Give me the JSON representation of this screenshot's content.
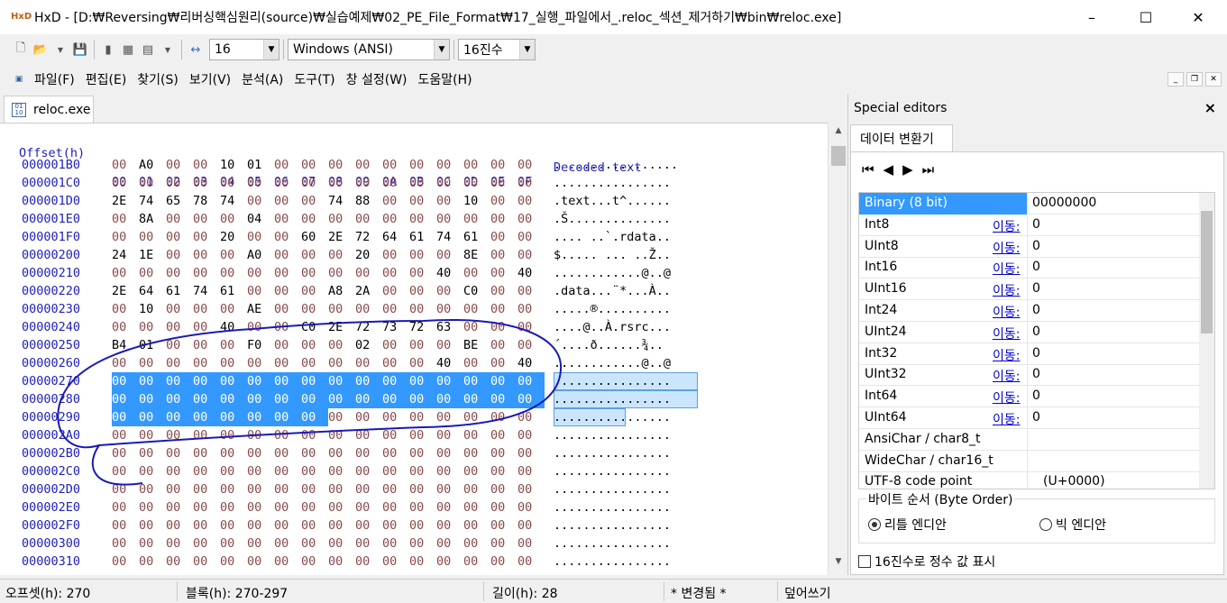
{
  "window": {
    "app_icon": "HxD",
    "title": "HxD - [D:₩Reversing₩리버싱핵심원리(source)₩실습예제₩02_PE_File_Format₩17_실행_파일에서_.reloc_섹션_제거하기₩bin₩reloc.exe]",
    "minimize": "–",
    "maximize": "☐",
    "close": "✕"
  },
  "toolbar": {
    "bytes_per_row": "16",
    "charset": "Windows (ANSI)",
    "base": "16진수"
  },
  "menu": [
    "파일(F)",
    "편집(E)",
    "찾기(S)",
    "보기(V)",
    "분석(A)",
    "도구(T)",
    "창 설정(W)",
    "도움말(H)"
  ],
  "document": {
    "tab_label": "reloc.exe",
    "icon": "file-icon"
  },
  "hex": {
    "header_offset": "Offset(h)",
    "header_cols": [
      "00",
      "01",
      "02",
      "03",
      "04",
      "05",
      "06",
      "07",
      "08",
      "09",
      "0A",
      "0B",
      "0C",
      "0D",
      "0E",
      "0F"
    ],
    "header_decoded": "Decoded text",
    "rows": [
      {
        "offset": "000001B0",
        "bytes": [
          "00",
          "A0",
          "00",
          "00",
          "10",
          "01",
          "00",
          "00",
          "00",
          "00",
          "00",
          "00",
          "00",
          "00",
          "00",
          "00"
        ],
        "text": ". ..............."
      },
      {
        "offset": "000001C0",
        "bytes": [
          "00",
          "00",
          "00",
          "00",
          "00",
          "00",
          "00",
          "00",
          "00",
          "00",
          "00",
          "00",
          "00",
          "00",
          "00",
          "00"
        ],
        "text": "................"
      },
      {
        "offset": "000001D0",
        "bytes": [
          "2E",
          "74",
          "65",
          "78",
          "74",
          "00",
          "00",
          "00",
          "74",
          "88",
          "00",
          "00",
          "00",
          "10",
          "00",
          "00"
        ],
        "text": ".text...t^......"
      },
      {
        "offset": "000001E0",
        "bytes": [
          "00",
          "8A",
          "00",
          "00",
          "00",
          "04",
          "00",
          "00",
          "00",
          "00",
          "00",
          "00",
          "00",
          "00",
          "00",
          "00"
        ],
        "text": ".Š.............."
      },
      {
        "offset": "000001F0",
        "bytes": [
          "00",
          "00",
          "00",
          "00",
          "20",
          "00",
          "00",
          "60",
          "2E",
          "72",
          "64",
          "61",
          "74",
          "61",
          "00",
          "00"
        ],
        "text": ".... ..`.rdata.."
      },
      {
        "offset": "00000200",
        "bytes": [
          "24",
          "1E",
          "00",
          "00",
          "00",
          "A0",
          "00",
          "00",
          "00",
          "20",
          "00",
          "00",
          "00",
          "8E",
          "00",
          "00"
        ],
        "text": "$..... ... ..Ž.."
      },
      {
        "offset": "00000210",
        "bytes": [
          "00",
          "00",
          "00",
          "00",
          "00",
          "00",
          "00",
          "00",
          "00",
          "00",
          "00",
          "00",
          "40",
          "00",
          "00",
          "40"
        ],
        "text": "............@..@"
      },
      {
        "offset": "00000220",
        "bytes": [
          "2E",
          "64",
          "61",
          "74",
          "61",
          "00",
          "00",
          "00",
          "A8",
          "2A",
          "00",
          "00",
          "00",
          "C0",
          "00",
          "00"
        ],
        "text": ".data...¨*...À.."
      },
      {
        "offset": "00000230",
        "bytes": [
          "00",
          "10",
          "00",
          "00",
          "00",
          "AE",
          "00",
          "00",
          "00",
          "00",
          "00",
          "00",
          "00",
          "00",
          "00",
          "00"
        ],
        "text": ".....®.........."
      },
      {
        "offset": "00000240",
        "bytes": [
          "00",
          "00",
          "00",
          "00",
          "40",
          "00",
          "00",
          "C0",
          "2E",
          "72",
          "73",
          "72",
          "63",
          "00",
          "00",
          "00"
        ],
        "text": "....@..À.rsrc..."
      },
      {
        "offset": "00000250",
        "bytes": [
          "B4",
          "01",
          "00",
          "00",
          "00",
          "F0",
          "00",
          "00",
          "00",
          "02",
          "00",
          "00",
          "00",
          "BE",
          "00",
          "00"
        ],
        "text": "´....ð......¾.."
      },
      {
        "offset": "00000260",
        "bytes": [
          "00",
          "00",
          "00",
          "00",
          "00",
          "00",
          "00",
          "00",
          "00",
          "00",
          "00",
          "00",
          "40",
          "00",
          "00",
          "40"
        ],
        "text": "............@..@"
      },
      {
        "offset": "00000270",
        "bytes": [
          "00",
          "00",
          "00",
          "00",
          "00",
          "00",
          "00",
          "00",
          "00",
          "00",
          "00",
          "00",
          "00",
          "00",
          "00",
          "00"
        ],
        "text": "................"
      },
      {
        "offset": "00000280",
        "bytes": [
          "00",
          "00",
          "00",
          "00",
          "00",
          "00",
          "00",
          "00",
          "00",
          "00",
          "00",
          "00",
          "00",
          "00",
          "00",
          "00"
        ],
        "text": "................"
      },
      {
        "offset": "00000290",
        "bytes": [
          "00",
          "00",
          "00",
          "00",
          "00",
          "00",
          "00",
          "00",
          "00",
          "00",
          "00",
          "00",
          "00",
          "00",
          "00",
          "00"
        ],
        "text": "................"
      },
      {
        "offset": "000002A0",
        "bytes": [
          "00",
          "00",
          "00",
          "00",
          "00",
          "00",
          "00",
          "00",
          "00",
          "00",
          "00",
          "00",
          "00",
          "00",
          "00",
          "00"
        ],
        "text": "................"
      },
      {
        "offset": "000002B0",
        "bytes": [
          "00",
          "00",
          "00",
          "00",
          "00",
          "00",
          "00",
          "00",
          "00",
          "00",
          "00",
          "00",
          "00",
          "00",
          "00",
          "00"
        ],
        "text": "................"
      },
      {
        "offset": "000002C0",
        "bytes": [
          "00",
          "00",
          "00",
          "00",
          "00",
          "00",
          "00",
          "00",
          "00",
          "00",
          "00",
          "00",
          "00",
          "00",
          "00",
          "00"
        ],
        "text": "................"
      },
      {
        "offset": "000002D0",
        "bytes": [
          "00",
          "00",
          "00",
          "00",
          "00",
          "00",
          "00",
          "00",
          "00",
          "00",
          "00",
          "00",
          "00",
          "00",
          "00",
          "00"
        ],
        "text": "................"
      },
      {
        "offset": "000002E0",
        "bytes": [
          "00",
          "00",
          "00",
          "00",
          "00",
          "00",
          "00",
          "00",
          "00",
          "00",
          "00",
          "00",
          "00",
          "00",
          "00",
          "00"
        ],
        "text": "................"
      },
      {
        "offset": "000002F0",
        "bytes": [
          "00",
          "00",
          "00",
          "00",
          "00",
          "00",
          "00",
          "00",
          "00",
          "00",
          "00",
          "00",
          "00",
          "00",
          "00",
          "00"
        ],
        "text": "................"
      },
      {
        "offset": "00000300",
        "bytes": [
          "00",
          "00",
          "00",
          "00",
          "00",
          "00",
          "00",
          "00",
          "00",
          "00",
          "00",
          "00",
          "00",
          "00",
          "00",
          "00"
        ],
        "text": "................"
      },
      {
        "offset": "00000310",
        "bytes": [
          "00",
          "00",
          "00",
          "00",
          "00",
          "00",
          "00",
          "00",
          "00",
          "00",
          "00",
          "00",
          "00",
          "00",
          "00",
          "00"
        ],
        "text": "................"
      }
    ],
    "selection_start": "0x270",
    "selection_end": "0x297"
  },
  "special_editors": {
    "title": "Special editors",
    "close": "×",
    "tab": "데이터 변환기",
    "jump_label": "이동:",
    "rows": [
      {
        "name": "Binary (8 bit)",
        "value": "00000000",
        "jump": false,
        "active": true
      },
      {
        "name": "Int8",
        "value": "0",
        "jump": true
      },
      {
        "name": "UInt8",
        "value": "0",
        "jump": true
      },
      {
        "name": "Int16",
        "value": "0",
        "jump": true
      },
      {
        "name": "UInt16",
        "value": "0",
        "jump": true
      },
      {
        "name": "Int24",
        "value": "0",
        "jump": true
      },
      {
        "name": "UInt24",
        "value": "0",
        "jump": true
      },
      {
        "name": "Int32",
        "value": "0",
        "jump": true
      },
      {
        "name": "UInt32",
        "value": "0",
        "jump": true
      },
      {
        "name": "Int64",
        "value": "0",
        "jump": true
      },
      {
        "name": "UInt64",
        "value": "0",
        "jump": true
      },
      {
        "name": "AnsiChar / char8_t",
        "value": "",
        "jump": false
      },
      {
        "name": "WideChar / char16_t",
        "value": "",
        "jump": false
      },
      {
        "name": "UTF-8 code point",
        "value": "(U+0000)",
        "jump": false
      }
    ],
    "byte_order_label": "바이트 순서 (Byte Order)",
    "little_endian": "리틀 엔디안",
    "big_endian": "빅 엔디안",
    "hex_checkbox": "16진수로 정수 값 표시"
  },
  "status": {
    "offset": "오프셋(h): 270",
    "block": "블록(h): 270-297",
    "length": "길이(h): 28",
    "modified": "* 변경됨 *",
    "mode": "덮어쓰기"
  },
  "colors": {
    "selection": "#3399ff",
    "offset_text": "#2020c0",
    "annotation_stroke": "#1a1ab8"
  }
}
